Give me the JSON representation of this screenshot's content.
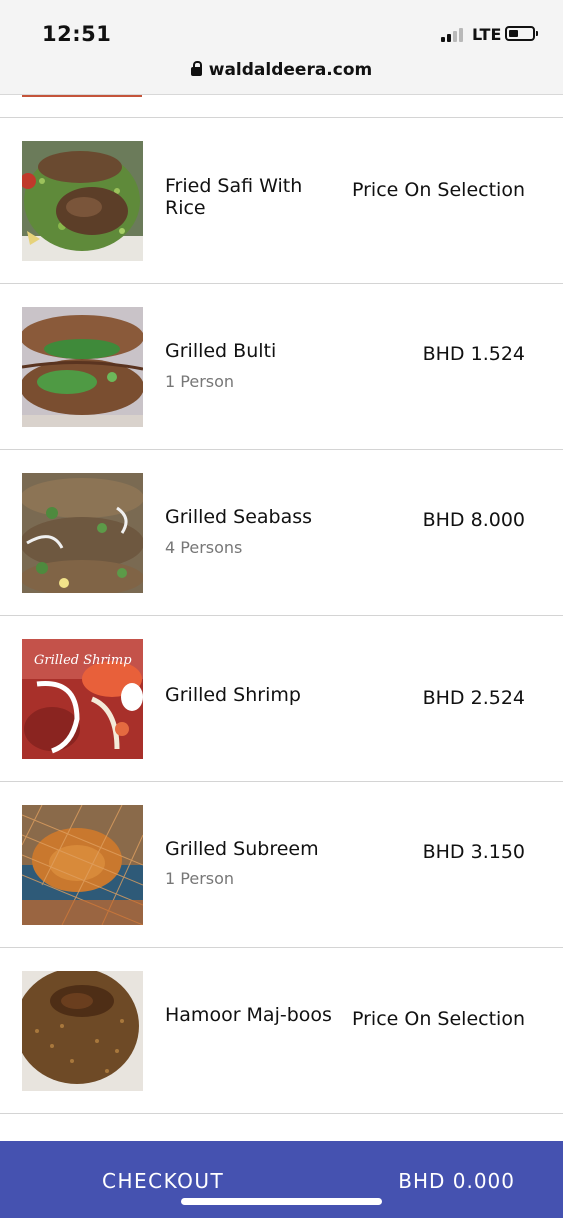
{
  "status_bar": {
    "time": "12:51",
    "network": "LTE",
    "url": "waldaldeera.com"
  },
  "menu": {
    "items": [
      {
        "name": "Fried Safi With Rice",
        "subtitle": "",
        "price": "Price On Selection",
        "image": "fried-safi-photo"
      },
      {
        "name": "Grilled Bulti",
        "subtitle": "1 Person",
        "price": "BHD 1.524",
        "image": "grilled-bulti-photo"
      },
      {
        "name": "Grilled Seabass",
        "subtitle": "4 Persons",
        "price": "BHD 8.000",
        "image": "grilled-seabass-photo"
      },
      {
        "name": "Grilled Shrimp",
        "subtitle": "",
        "price": "BHD 2.524",
        "image": "grilled-shrimp-photo",
        "image_caption": "Grilled Shrimp"
      },
      {
        "name": "Grilled Subreem",
        "subtitle": "1 Person",
        "price": "BHD 3.150",
        "image": "grilled-subreem-photo"
      },
      {
        "name": "Hamoor Maj-boos",
        "subtitle": "",
        "price": "Price On Selection",
        "image": "hamoor-majboos-photo"
      }
    ]
  },
  "checkout": {
    "label": "CHECKOUT",
    "total": "BHD 0.000"
  },
  "colors": {
    "checkout_bar": "#4552b0",
    "status_bar_bg": "#f4f4f4",
    "divider": "#d4d4d4",
    "subtitle_text": "#777777"
  }
}
